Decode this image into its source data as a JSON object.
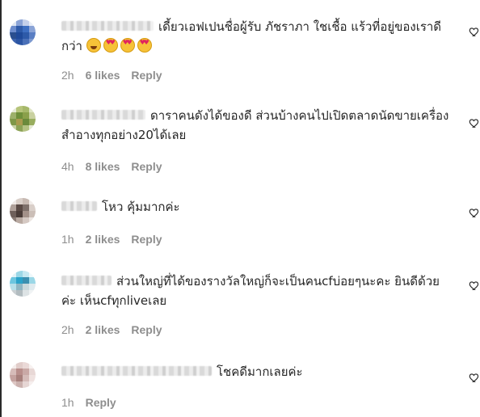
{
  "comments": [
    {
      "text": "เดี้ยวเอฟเปนชื่อผู้รับ ภัชราภา ใชเชื้อ แร้วที่อยู่ของเราดีกว่า",
      "time": "2h",
      "likes": "6 likes",
      "reply": "Reply",
      "emojis": [
        "rolling-on-floor-laughing-icon",
        "heart-eyes-icon",
        "heart-eyes-icon",
        "heart-eyes-icon"
      ],
      "avatar_colors": [
        "#2d5aa8",
        "#3d6fc2",
        "#6f8ed0",
        "#2a4f8f"
      ]
    },
    {
      "text": "ดาราคนดังได้ของดี ส่วนบ้างคนไปเปิดตลาดนัดขายเครื่องสำอางทุกอย่าง20ได้เลย",
      "time": "4h",
      "likes": "8 likes",
      "reply": "Reply",
      "emojis": [],
      "avatar_colors": [
        "#8aa04a",
        "#b6c47a",
        "#6e8f3a",
        "#c9d1a0"
      ]
    },
    {
      "text": "โหว คุ้มมากค่ะ",
      "time": "1h",
      "likes": "2 likes",
      "reply": "Reply",
      "emojis": [],
      "avatar_colors": [
        "#5a4a45",
        "#b0a19a",
        "#7d6f6a",
        "#d9cfc9"
      ]
    },
    {
      "text": "ส่วนใหญ่ที่ได้ของรางวัลใหญ่ก็จะเป็นคนcfบ่อยๆนะคะ ยินดีด้วยค่ะ เห็นcfทุกliveเลย",
      "time": "2h",
      "likes": "2 likes",
      "reply": "Reply",
      "emojis": [],
      "avatar_colors": [
        "#2aa2c9",
        "#6dc6df",
        "#9bd7e6",
        "#3b8fb0"
      ]
    },
    {
      "text": "โชคดีมากเลยค่ะ",
      "time": "1h",
      "likes": "",
      "reply": "Reply",
      "emojis": [],
      "avatar_colors": [
        "#c9a9a6",
        "#e1cdca",
        "#b88e8b",
        "#efe2e0"
      ]
    }
  ],
  "heart_icon": "heart-outline-icon"
}
